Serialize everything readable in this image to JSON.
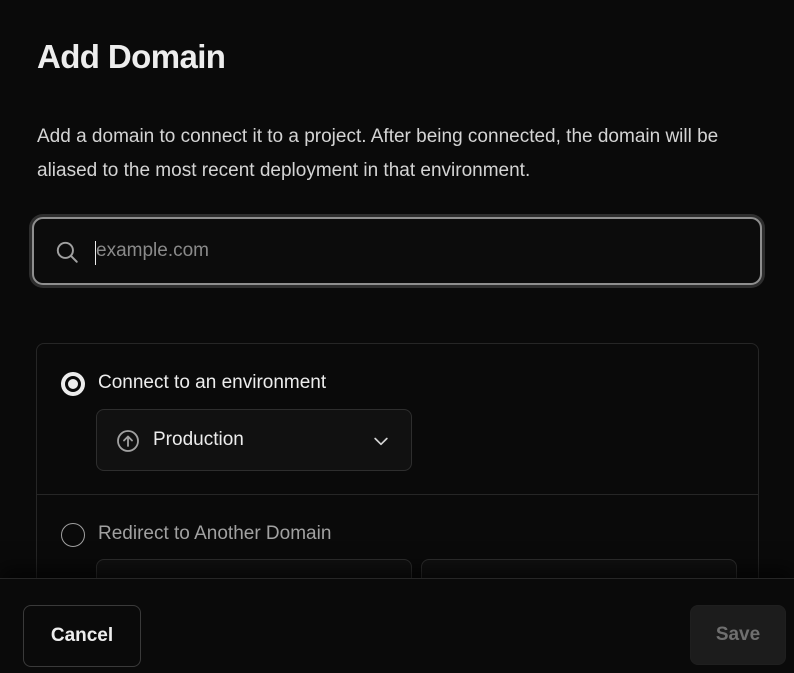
{
  "dialog": {
    "title": "Add Domain",
    "description": "Add a domain to connect it to a project. After being connected, the domain will be aliased to the most recent deployment in that environment."
  },
  "search": {
    "placeholder": "example.com",
    "value": "",
    "icon": "search-icon"
  },
  "options": {
    "connect": {
      "label": "Connect to an environment",
      "selected": true,
      "environment": {
        "value": "Production",
        "icon": "arrow-up-circle-icon",
        "dropdown_icon": "chevron-down-icon"
      }
    },
    "redirect": {
      "label": "Redirect to Another Domain",
      "selected": false
    }
  },
  "footer": {
    "cancel_label": "Cancel",
    "save_label": "Save"
  },
  "colors": {
    "background": "#0a0a0a",
    "text": "#ededed",
    "muted_text": "#a1a1a1",
    "border": "#262626",
    "disabled_button": "#1c1c1c"
  }
}
